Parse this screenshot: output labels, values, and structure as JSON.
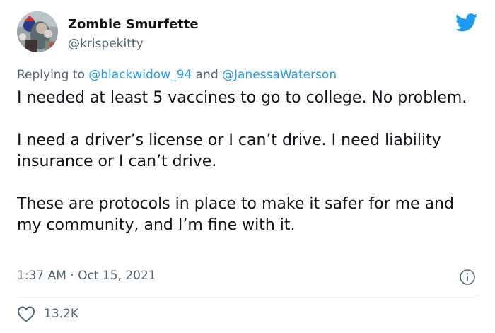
{
  "author": {
    "display_name": "Zombie Smurfette",
    "handle": "@krispekitty"
  },
  "reply_context": {
    "prefix": "Replying to",
    "mention_1": "@blackwidow_94",
    "conjunction": "and",
    "mention_2": "@JanessaWaterson"
  },
  "tweet": {
    "paragraphs": [
      "I needed at least 5 vaccines to go to college. No problem.",
      "I need a driver’s license or I can’t drive. I need liability insurance or I can’t drive.",
      "These are protocols in place to make it safer for me and my community, and I’m fine with it."
    ],
    "timestamp": "1:37 AM · Oct 15, 2021"
  },
  "engagement": {
    "like_count": "13.2K"
  },
  "icons": {
    "brand": "twitter-bird-icon",
    "info": "info-icon",
    "like": "heart-icon"
  },
  "colors": {
    "brand_blue": "#1d9bf0",
    "text": "#0f1419",
    "secondary_text": "#536471",
    "divider": "#cfd9de"
  }
}
